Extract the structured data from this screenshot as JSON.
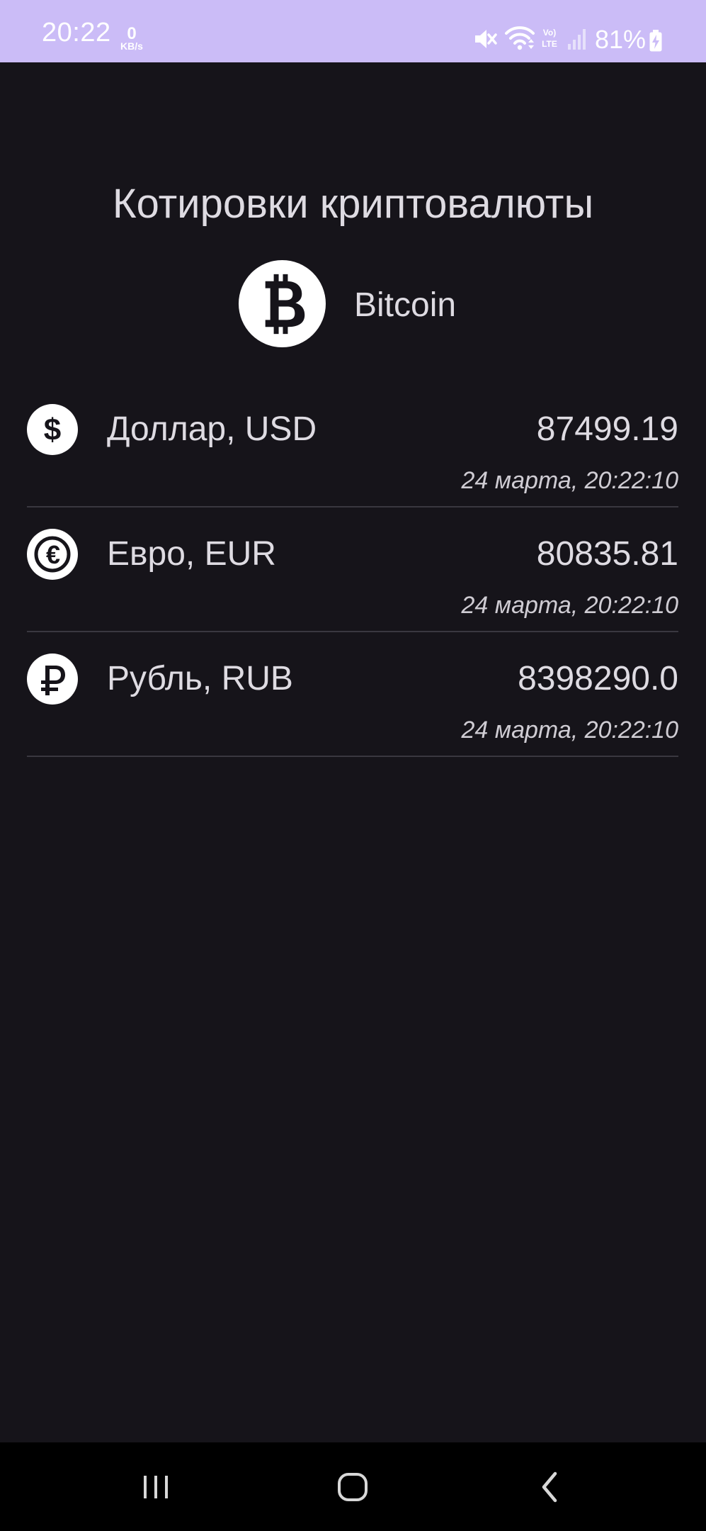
{
  "status_bar": {
    "time": "20:22",
    "net_speed_value": "0",
    "net_speed_unit": "KB/s",
    "signal_label": "Vo) LTE",
    "battery_percent": "81%",
    "icons": [
      "mute-icon",
      "wifi-icon",
      "volte-lte-icon",
      "signal-icon",
      "battery-charging-icon"
    ]
  },
  "page": {
    "title": "Котировки криптовалюты"
  },
  "coin": {
    "name": "Bitcoin",
    "icon": "bitcoin-icon"
  },
  "quotes": [
    {
      "label": "Доллар, USD",
      "value": "87499.19",
      "updated": "24 марта, 20:22:10",
      "icon": "dollar-icon"
    },
    {
      "label": "Евро, EUR",
      "value": "80835.81",
      "updated": "24 марта, 20:22:10",
      "icon": "euro-icon"
    },
    {
      "label": "Рубль, RUB",
      "value": "8398290.0",
      "updated": "24 марта, 20:22:10",
      "icon": "ruble-icon"
    }
  ],
  "nav_bar": {
    "buttons": [
      "recents-icon",
      "home-icon",
      "back-icon"
    ]
  },
  "colors": {
    "background": "#16141a",
    "status_bar": "#cbbcf7",
    "text": "#dedbe2",
    "divider": "#3a3840",
    "nav_bar": "#000000"
  }
}
